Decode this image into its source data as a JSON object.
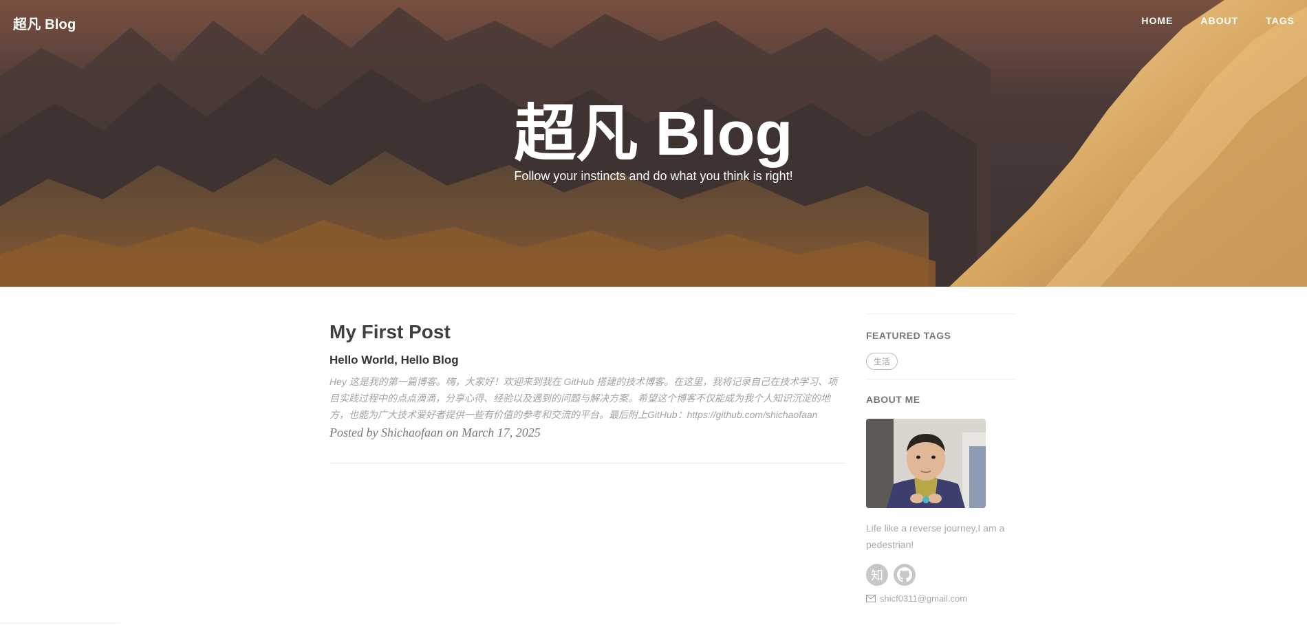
{
  "nav": {
    "brand": "超凡 Blog",
    "links": [
      "HOME",
      "ABOUT",
      "TAGS"
    ]
  },
  "hero": {
    "title": "超凡 Blog",
    "subtitle": "Follow your instincts and do what you think is right!"
  },
  "post": {
    "title": "My First Post",
    "subtitle": "Hello World, Hello Blog",
    "excerpt": "Hey 这是我的第一篇博客。嗨，大家好！欢迎来到我在 GitHub 搭建的技术博客。在这里，我将记录自己在技术学习、项目实践过程中的点点滴滴，分享心得、经验以及遇到的问题与解决方案。希望这个博客不仅能成为我个人知识沉淀的地方，也能为广大技术爱好者提供一些有价值的参考和交流的平台。最后附上GitHub：https://github.com/shichaofaan",
    "meta": "Posted by Shichaofaan on March 17, 2025"
  },
  "sidebar": {
    "featured_tags_heading": "FEATURED TAGS",
    "tags": [
      "生活"
    ],
    "about_heading": "ABOUT ME",
    "bio": "Life like a reverse journey,I am a pedestrian!",
    "social": {
      "zhihu_glyph": "知",
      "zhihu_icon": "zhihu-icon",
      "github_icon": "github-icon"
    },
    "email": "shicf0311@gmail.com"
  },
  "colors": {
    "heading": "#404040",
    "muted": "#aaaaaa",
    "meta": "#777777",
    "social_bg": "#c7c7c7"
  }
}
